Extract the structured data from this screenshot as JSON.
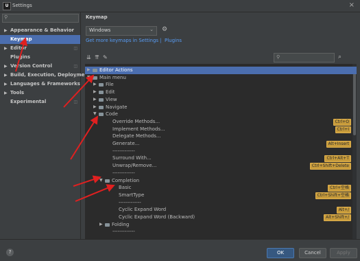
{
  "window": {
    "title": "Settings",
    "app_icon": "U",
    "close_symbol": "×"
  },
  "sidebar": {
    "search_placeholder": "",
    "items": [
      {
        "label": "Appearance & Behavior",
        "arrow": "▶",
        "selected": false
      },
      {
        "label": "Keymap",
        "arrow": "",
        "selected": true
      },
      {
        "label": "Editor",
        "arrow": "▶",
        "selected": false
      },
      {
        "label": "Plugins",
        "arrow": "",
        "selected": false
      },
      {
        "label": "Version Control",
        "arrow": "▶",
        "selected": false
      },
      {
        "label": "Build, Execution, Deployment",
        "arrow": "▶",
        "selected": false
      },
      {
        "label": "Languages & Frameworks",
        "arrow": "▶",
        "selected": false
      },
      {
        "label": "Tools",
        "arrow": "▶",
        "selected": false
      },
      {
        "label": "Experimental",
        "arrow": "",
        "selected": false
      }
    ]
  },
  "main": {
    "title": "Keymap",
    "keymap_select": "Windows",
    "link_text": "Get more keymaps in Settings",
    "link_sep": "|",
    "link_plugins": "Plugins",
    "filter_placeholder": ""
  },
  "tree": [
    {
      "label": "Editor Actions",
      "indent": 0,
      "exp": "▶",
      "folder": true,
      "selected": true,
      "shortcut": ""
    },
    {
      "label": "Main menu",
      "indent": 0,
      "exp": "▼",
      "folder": true,
      "selected": false,
      "shortcut": ""
    },
    {
      "label": "File",
      "indent": 1,
      "exp": "▶",
      "folder": true,
      "selected": false,
      "shortcut": ""
    },
    {
      "label": "Edit",
      "indent": 1,
      "exp": "▶",
      "folder": true,
      "selected": false,
      "shortcut": ""
    },
    {
      "label": "View",
      "indent": 1,
      "exp": "▶",
      "folder": true,
      "selected": false,
      "shortcut": ""
    },
    {
      "label": "Navigate",
      "indent": 1,
      "exp": "▶",
      "folder": true,
      "selected": false,
      "shortcut": ""
    },
    {
      "label": "Code",
      "indent": 1,
      "exp": "▼",
      "folder": true,
      "selected": false,
      "shortcut": ""
    },
    {
      "label": "Override Methods...",
      "indent": 3,
      "exp": "",
      "folder": false,
      "selected": false,
      "shortcut": "Ctrl+O"
    },
    {
      "label": "Implement Methods...",
      "indent": 3,
      "exp": "",
      "folder": false,
      "selected": false,
      "shortcut": "Ctrl+I"
    },
    {
      "label": "Delegate Methods...",
      "indent": 3,
      "exp": "",
      "folder": false,
      "selected": false,
      "shortcut": ""
    },
    {
      "label": "Generate...",
      "indent": 3,
      "exp": "",
      "folder": false,
      "selected": false,
      "shortcut": "Alt+Insert"
    },
    {
      "label": "-------------",
      "indent": 3,
      "exp": "",
      "folder": false,
      "selected": false,
      "shortcut": ""
    },
    {
      "label": "Surround With...",
      "indent": 3,
      "exp": "",
      "folder": false,
      "selected": false,
      "shortcut": "Ctrl+Alt+T"
    },
    {
      "label": "Unwrap/Remove...",
      "indent": 3,
      "exp": "",
      "folder": false,
      "selected": false,
      "shortcut": "Ctrl+Shift+Delete"
    },
    {
      "label": "-------------",
      "indent": 3,
      "exp": "",
      "folder": false,
      "selected": false,
      "shortcut": ""
    },
    {
      "label": "Completion",
      "indent": 2,
      "exp": "▼",
      "folder": true,
      "selected": false,
      "shortcut": ""
    },
    {
      "label": "Basic",
      "indent": 4,
      "exp": "",
      "folder": false,
      "selected": false,
      "shortcut": "Ctrl+空格"
    },
    {
      "label": "SmartType",
      "indent": 4,
      "exp": "",
      "folder": false,
      "selected": false,
      "shortcut": "Ctrl+Shift+空格"
    },
    {
      "label": "-------------",
      "indent": 4,
      "exp": "",
      "folder": false,
      "selected": false,
      "shortcut": ""
    },
    {
      "label": "Cyclic Expand Word",
      "indent": 4,
      "exp": "",
      "folder": false,
      "selected": false,
      "shortcut": "Alt+/"
    },
    {
      "label": "Cyclic Expand Word (Backward)",
      "indent": 4,
      "exp": "",
      "folder": false,
      "selected": false,
      "shortcut": "Alt+Shift+/"
    },
    {
      "label": "Folding",
      "indent": 2,
      "exp": "▶",
      "folder": true,
      "selected": false,
      "shortcut": ""
    },
    {
      "label": "-------------",
      "indent": 3,
      "exp": "",
      "folder": false,
      "selected": false,
      "shortcut": ""
    }
  ],
  "footer": {
    "help": "?",
    "ok": "OK",
    "cancel": "Cancel",
    "apply": "Apply"
  },
  "colors": {
    "accent": "#4b6eaf",
    "annotation_arrow": "#e02020",
    "shortcut_bg": "#c79b3b"
  }
}
